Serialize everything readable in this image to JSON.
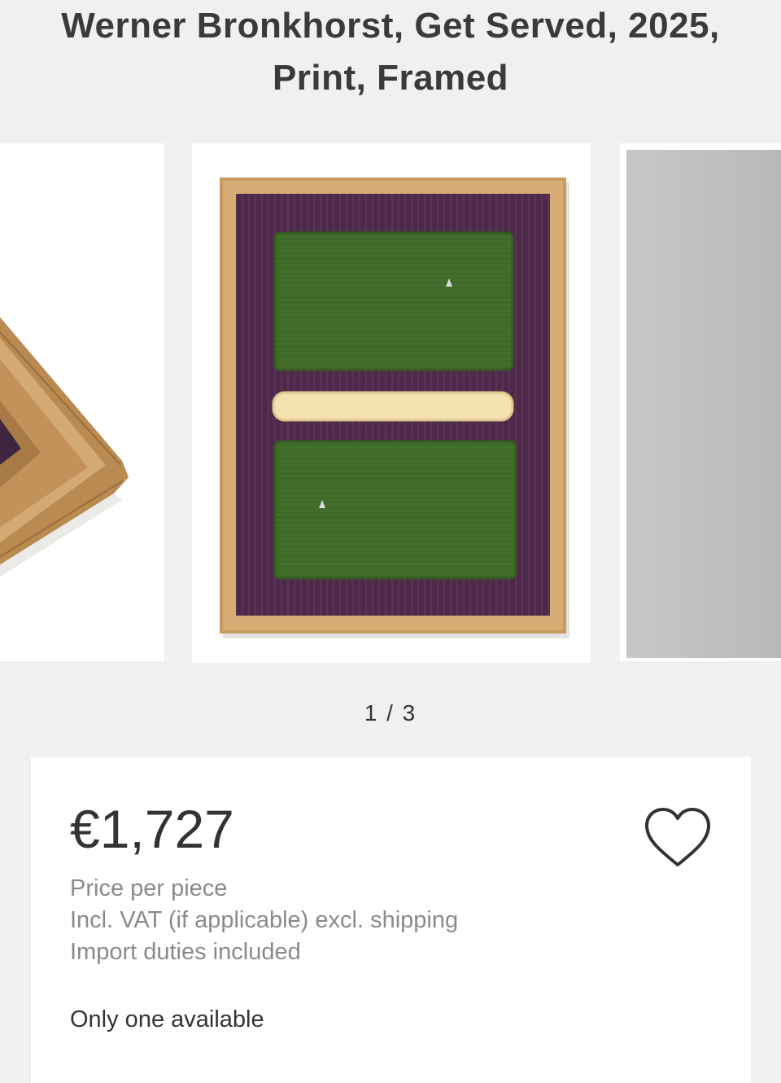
{
  "product": {
    "title_line1": "Werner Bronkhorst, Get Served, 2025,",
    "title_line2": "Print, Framed"
  },
  "carousel": {
    "counter": "1 / 3",
    "current": 1,
    "total": 3
  },
  "pricing": {
    "price": "€1,727",
    "price_per_piece": "Price per piece",
    "vat_note": "Incl. VAT (if applicable) excl. shipping",
    "duties_note": "Import duties included",
    "availability": "Only one available"
  },
  "icons": {
    "favorite": "heart-outline-icon"
  },
  "colors": {
    "background": "#f0f0f0",
    "card": "#ffffff",
    "text": "#333333",
    "muted_text": "#8a8a8a",
    "artwork_purple": "#4e2a4a",
    "artwork_green": "#3f6b2a",
    "artwork_cream": "#f3e2b0",
    "frame_wood": "#c89a5e"
  }
}
